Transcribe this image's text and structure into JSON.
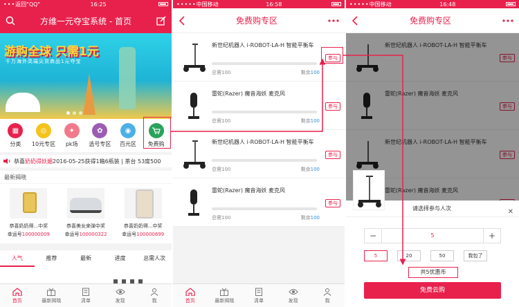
{
  "colors": {
    "accent": "#e8214c",
    "link": "#2a8fd6"
  },
  "screen1": {
    "status": {
      "left": "返回\"QQ\"",
      "time": "16:25"
    },
    "nav_title": "方维一元夺宝系统 - 首页",
    "banner": {
      "slogan": "游购全球 只需1元",
      "subline": "千万海外高端尖货商品1元夺宝"
    },
    "categories": [
      {
        "label": "分类",
        "icon": "grid-icon",
        "color": "#e8214c"
      },
      {
        "label": "10元专区",
        "icon": "ten-icon",
        "color": "#f6c21c"
      },
      {
        "label": "pk场",
        "icon": "pk-icon",
        "color": "#f07a8a"
      },
      {
        "label": "选号专区",
        "icon": "select-icon",
        "color": "#9b5cb4"
      },
      {
        "label": "百元区",
        "icon": "camera-icon",
        "color": "#4cb0e6"
      },
      {
        "label": "免费购",
        "icon": "cart-icon",
        "color": "#2aa35a"
      }
    ],
    "notice": {
      "prefix": "恭喜",
      "name": "奶奶得妖媚",
      "text": "2016-05-25获得1箱6瓶装 | 茶台 53度500"
    },
    "latest_title": "最新揭晓",
    "latest": [
      {
        "name": "恭喜奶奶得...中奖",
        "lucky_label": "幸运号",
        "lucky_no": "100000009"
      },
      {
        "name": "恭喜美女来弹中奖",
        "lucky_label": "幸运号",
        "lucky_no": "100000322"
      },
      {
        "name": "恭喜奶奶得...中奖",
        "lucky_label": "幸运号",
        "lucky_no": "100000699"
      }
    ],
    "tabs": [
      "人气",
      "推荐",
      "最新",
      "进度",
      "总需人次"
    ],
    "tabbar": [
      "首页",
      "最新揭晓",
      "清单",
      "发现",
      "我"
    ]
  },
  "screen2": {
    "status": {
      "left": "中国移动",
      "time": "16:58"
    },
    "nav_title": "免费购专区",
    "products": [
      {
        "name": "新世纪机器人 i-ROBOT-LA-H 智能平衡车",
        "need": "总需100",
        "left_label": "剩余",
        "left": "100",
        "join": "参与"
      },
      {
        "name": "雷蛇(Razer) 魔音海妖 麦克风",
        "need": "总需100",
        "left_label": "剩余",
        "left": "100",
        "join": "参与"
      },
      {
        "name": "新世纪机器人 i-ROBOT-LA-H 智能平衡车",
        "need": "总需100",
        "left_label": "剩余",
        "left": "100",
        "join": "参与"
      },
      {
        "name": "雷蛇(Razer) 魔音海妖 麦克风",
        "need": "总需100",
        "left_label": "剩余",
        "left": "100",
        "join": "参与"
      }
    ],
    "tabbar": [
      "首页",
      "最新揭晓",
      "清单",
      "发现",
      "我"
    ]
  },
  "screen3": {
    "status": {
      "left": "中国移动",
      "time": "16:48"
    },
    "nav_title": "免费购专区",
    "bg_products": [
      {
        "name": "新世纪机器人 i-ROBOT-LA-H 智能平衡车",
        "join": "参与"
      },
      {
        "name": "雷蛇(Razer) 魔音海妖 麦克风",
        "join": "参与"
      },
      {
        "name": "新世纪机器人 i-ROBOT-LA-H 智能平衡车",
        "join": "参与"
      },
      {
        "name": "雷蛇(Razer) 魔音海妖 麦克风",
        "join": "参与"
      }
    ],
    "sheet": {
      "title": "请选择参与人次",
      "minus": "−",
      "plus": "+",
      "quantity": "5",
      "quick": [
        "5",
        "20",
        "50",
        "我包了"
      ],
      "total": "共5优惠币",
      "button": "免费云购"
    }
  }
}
